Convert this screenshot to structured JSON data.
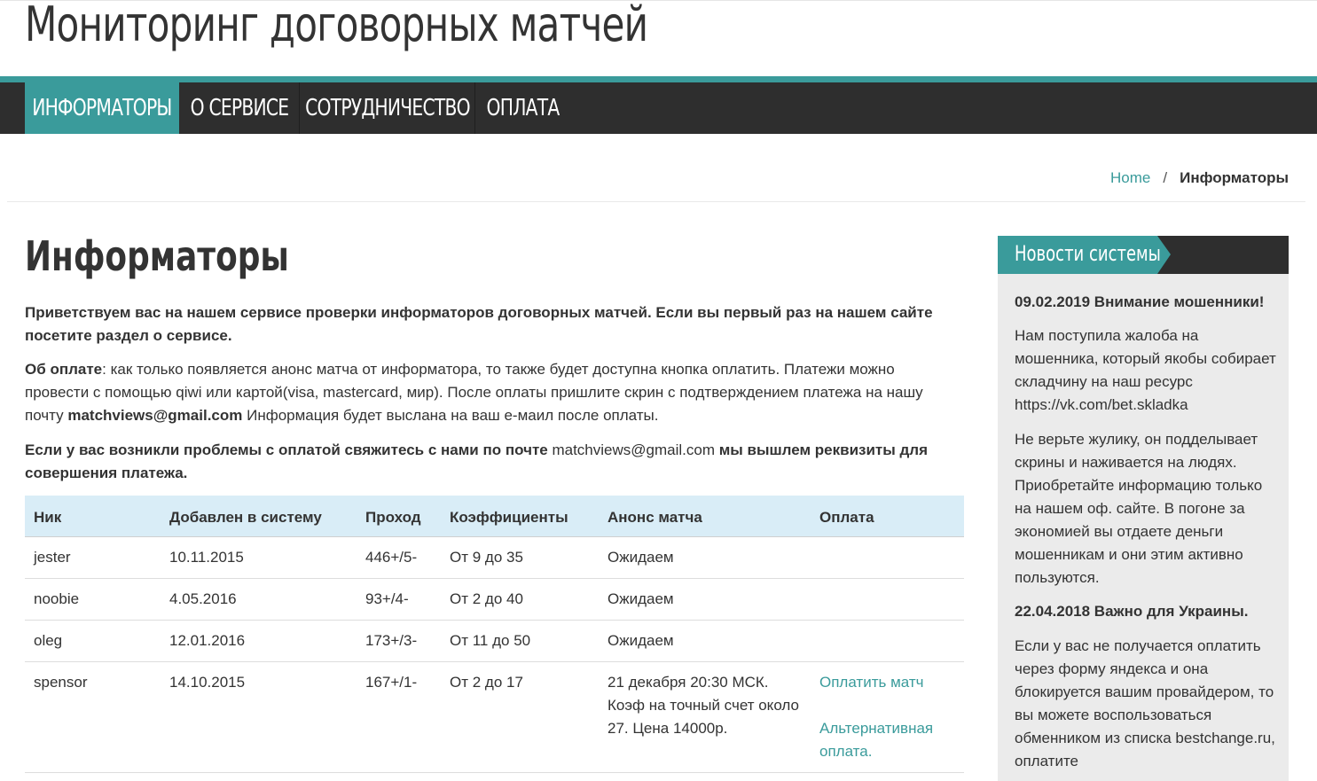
{
  "site": {
    "title": "Мониторинг договорных матчей"
  },
  "nav": {
    "items": [
      "ИНФОРМАТОРЫ",
      "О СЕРВИСЕ",
      "СОТРУДНИЧЕСТВО",
      "ОПЛАТА"
    ]
  },
  "breadcrumb": {
    "home": "Home",
    "separator": "/",
    "current": "Информаторы"
  },
  "page": {
    "title": "Информаторы",
    "intro": "Приветствуем вас на нашем сервисе проверки информаторов договорных матчей. Если вы первый раз на нашем сайте посетите раздел о сервисе.",
    "payment_label": "Об оплате",
    "payment_text": ": как только появляется анонс матча от информатора, то также будет доступна кнопка оплатить. Платежи можно провести с помощью qiwi или картой(visa, mastercard, мир). После оплаты пришлите скрин с подтверждением платежа на нашу почту ",
    "payment_email": "matchviews@gmail.com",
    "payment_after": " Информация будет выслана на ваш е-маил после оплаты.",
    "problems_before": "Если у вас возникли проблемы с оплатой свяжитесь с нами по почте ",
    "problems_email": "matchviews@gmail.com",
    "problems_after": " мы вышлем реквизиты для совершения платежа."
  },
  "table": {
    "headers": [
      "Ник",
      "Добавлен в систему",
      "Проход",
      "Коэффициенты",
      "Анонс матча",
      "Оплата"
    ],
    "rows": [
      {
        "nick": "jester",
        "added": "10.11.2015",
        "pass": "446+/5-",
        "coef": "От 9 до 35",
        "announce": "Ожидаем",
        "pay": "",
        "pay_alt": ""
      },
      {
        "nick": "noobie",
        "added": "4.05.2016",
        "pass": "93+/4-",
        "coef": "От 2 до 40",
        "announce": "Ожидаем",
        "pay": "",
        "pay_alt": ""
      },
      {
        "nick": "oleg",
        "added": "12.01.2016",
        "pass": "173+/3-",
        "coef": "От 11 до 50",
        "announce": "Ожидаем",
        "pay": "",
        "pay_alt": ""
      },
      {
        "nick": "spensor",
        "added": "14.10.2015",
        "pass": "167+/1-",
        "coef": "От 2 до 17",
        "announce": "21 декабря 20:30 МСК.\nКоэф на точный счет около 27. Цена 14000р.",
        "pay": "Оплатить матч",
        "pay_alt": "Альтернативная оплата."
      }
    ]
  },
  "sidebar": {
    "title": "Новости системы",
    "news1_title": "09.02.2019 Внимание мошенники!",
    "news1_p1": "Нам поступила жалоба на мошенника, который якобы собирает складчину на наш ресурс https://vk.com/bet.skladka",
    "news1_p2": "Не верьте жулику, он подделывает скрины и наживается на людях. Приобретайте информацию только на нашем оф. сайте. В погоне за экономией вы отдаете деньги мошенникам и они этим активно пользуются.",
    "news2_title": "22.04.2018 Важно для Украины.",
    "news2_p1": "Если у вас не получается оплатить через форму яндекса и она блокируется вашим провайдером, то вы можете воспользоваться обменником из списка bestchange.ru, оплатите"
  },
  "colors": {
    "accent": "#3a9b9b",
    "nav_bg": "#2e2e2e",
    "table_header": "#d9edf7",
    "sidebar_bg": "#ebebeb"
  }
}
